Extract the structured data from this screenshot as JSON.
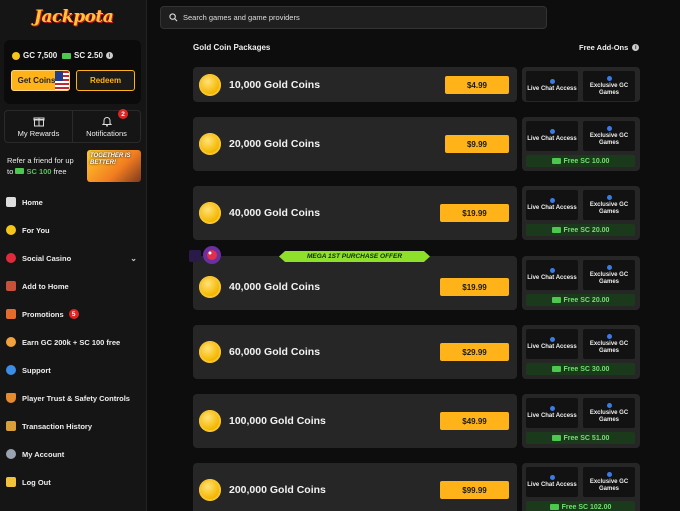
{
  "brand": {
    "logo_text": "Jackpota"
  },
  "wallet": {
    "gc_balance": "GC 7,500",
    "sc_balance": "SC 2.50",
    "get_coins_label": "Get Coins",
    "redeem_label": "Redeem"
  },
  "quick": {
    "rewards_label": "My Rewards",
    "notifications_label": "Notifications",
    "notifications_count": "2"
  },
  "refer": {
    "line1": "Refer a friend for up",
    "line2_prefix": "to",
    "line2_sc": "SC 100",
    "line2_suffix": "free",
    "art_text": "TOGETHER IS BETTER!"
  },
  "nav": {
    "items": [
      {
        "label": "Home",
        "icon": "home-icon"
      },
      {
        "label": "For You",
        "icon": "for-you-icon"
      },
      {
        "label": "Social Casino",
        "icon": "cherry-icon"
      },
      {
        "label": "Add to Home",
        "icon": "add-home-icon"
      },
      {
        "label": "Promotions",
        "icon": "gift-icon",
        "badge": "5"
      },
      {
        "label": "Earn GC 200k + SC 100 free",
        "icon": "users-icon"
      },
      {
        "label": "Support",
        "icon": "support-icon"
      },
      {
        "label": "Player Trust & Safety Controls",
        "icon": "shield-icon"
      },
      {
        "label": "Transaction History",
        "icon": "history-icon"
      },
      {
        "label": "My Account",
        "icon": "account-icon"
      },
      {
        "label": "Log Out",
        "icon": "logout-icon"
      }
    ]
  },
  "search": {
    "placeholder": "Search games and game providers"
  },
  "store": {
    "section_title": "Gold Coin Packages",
    "addons_title": "Free Add-Ons",
    "mega_offer": "MEGA 1ST PURCHASE OFFER",
    "live_chat_label": "Live Chat Access",
    "exclusive_label": "Exclusive GC Games",
    "packages": [
      {
        "amount": "10,000 Gold Coins",
        "price": "$4.99",
        "free_sc": ""
      },
      {
        "amount": "20,000 Gold Coins",
        "price": "$9.99",
        "free_sc": "Free SC 10.00"
      },
      {
        "amount": "40,000 Gold Coins",
        "price": "$19.99",
        "free_sc": "Free SC 20.00"
      },
      {
        "amount": "40,000 Gold Coins",
        "price": "$19.99",
        "free_sc": "Free SC 20.00"
      },
      {
        "amount": "60,000 Gold Coins",
        "price": "$29.99",
        "free_sc": "Free SC 30.00"
      },
      {
        "amount": "100,000 Gold Coins",
        "price": "$49.99",
        "free_sc": "Free SC 51.00"
      },
      {
        "amount": "200,000 Gold Coins",
        "price": "$99.99",
        "free_sc": "Free SC 102.00"
      }
    ]
  },
  "colors": {
    "accent": "#ffb319",
    "sc_green": "#4cc84f",
    "background": "#0d0d0d",
    "card": "#262626"
  }
}
